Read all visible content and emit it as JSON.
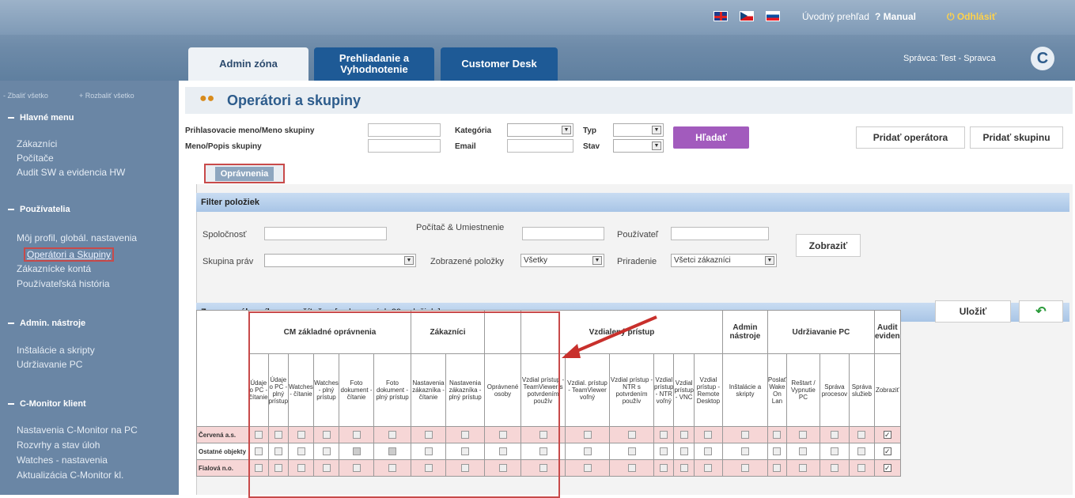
{
  "header": {
    "overview": "Úvodný prehľad",
    "manual": "Manual",
    "logout": "Odhlásiť",
    "spravca": "Správca: Test - Spravca",
    "logo": "C"
  },
  "tabs": [
    {
      "label": "Admin zóna"
    },
    {
      "label": "Prehliadanie a Vyhodnotenie"
    },
    {
      "label": "Customer Desk"
    }
  ],
  "sidebar": {
    "collapse_all": "- Zbaliť všetko",
    "expand_all": "+ Rozbaliť všetko",
    "groups": [
      {
        "label": "Hlavné menu",
        "items": [
          "Zákazníci",
          "Počítače",
          "Audit SW a evidencia HW"
        ]
      },
      {
        "label": "Používatelia",
        "items": [
          "Môj profil, globál. nastavenia",
          "Operátori a Skupiny",
          "Zákaznícke kontá",
          "Používateľská história"
        ]
      },
      {
        "label": "Admin. nástroje",
        "items": [
          "Inštalácie a skripty",
          "Udržiavanie PC"
        ]
      },
      {
        "label": "C-Monitor klient",
        "items": [
          "Nastavenia C-Monitor na PC",
          "Rozvrhy a stav úloh",
          "Watches - nastavenia",
          "Aktualizácia C-Monitor kl."
        ]
      }
    ]
  },
  "page": {
    "title": "Operátori a skupiny"
  },
  "search": {
    "login_label": "Prihlasovacie meno/Meno skupiny",
    "name_label": "Meno/Popis skupiny",
    "kategoria": "Kategória",
    "email": "Email",
    "typ": "Typ",
    "stav": "Stav",
    "hladat": "Hľadať",
    "add_operator": "Pridať operátora",
    "add_group": "Pridať skupinu"
  },
  "subtab": {
    "label": "Oprávnenia"
  },
  "filter": {
    "title": "Filter položiek",
    "spolocnost": "Spoločnosť",
    "pocitac": "Počítač & Umiestnenie",
    "pouzivatel": "Používateľ",
    "skupina": "Skupina práv",
    "zobrazene": "Zobrazené položky",
    "zobrazene_val": "Všetky",
    "priradenie": "Priradenie",
    "priradenie_val": "Všetci zákazníci",
    "zobrazit": "Zobraziť"
  },
  "list": {
    "title_bold": "Zoznam zákazníkov a počítačov",
    "title_rest": " [ zobrazených 29 položiek ]",
    "save": "Uložiť"
  },
  "table": {
    "groups": [
      "CM základné oprávnenia",
      "Zákazníci",
      "Vzdialený prístup",
      "Admin nástroje",
      "Udržiavanie PC",
      "Audit eviden"
    ],
    "cols": [
      "Údaje o PC - čítanie",
      "Údaje o PC - plný prístup",
      "Watches - čítanie",
      "Watches - plný prístup",
      "Foto dokument - čítanie",
      "Foto dokument - plný prístup",
      "Nastavenia zákazníka - čítanie",
      "Nastavenia zákazníka - plný prístup",
      "Oprávnené osoby",
      "Vzdial prístup - TeamViewer s potvrdením použív",
      "Vzdial. prístup - TeamViewer voľný",
      "Vzdial prístup - NTR s potvrdením použív",
      "Vzdial prístup - NTR voľný",
      "Vzdial prístup - VNC",
      "Vzdial prístup - Remote Desktop",
      "Inštalácie a skripty",
      "Poslať Wake On Lan",
      "Reštart / Vypnutie PC",
      "Správa procesov",
      "Správa služieb",
      "Zobraziť"
    ],
    "rows": [
      {
        "label": "Červená a.s."
      },
      {
        "label": "Ostatné objekty"
      },
      {
        "label": "Fialová n.o."
      }
    ]
  }
}
